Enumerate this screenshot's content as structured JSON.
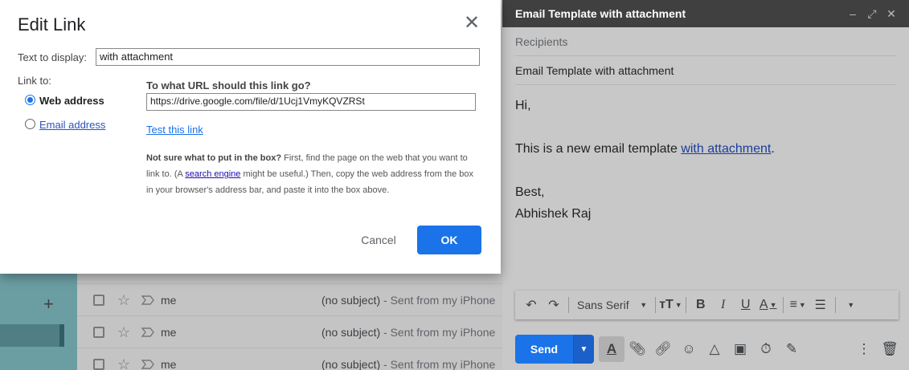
{
  "dialog": {
    "title": "Edit Link",
    "text_to_display_label": "Text to display:",
    "text_to_display_value": "with attachment",
    "link_to_label": "Link to:",
    "options": [
      {
        "label": "Web address",
        "selected": true
      },
      {
        "label": "Email address",
        "selected": false
      }
    ],
    "url_question": "To what URL should this link go?",
    "url_value": "https://drive.google.com/file/d/1Ucj1VmyKQVZRSt",
    "test_link": "Test this link",
    "help_bold": "Not sure what to put in the box?",
    "help_text_1": " First, find the page on the web that you want to link to. (A ",
    "help_link": "search engine",
    "help_text_2": " might be useful.) Then, copy the web address from the box in your browser's address bar, and paste it into the box above.",
    "cancel_label": "Cancel",
    "ok_label": "OK",
    "close_icon": "close-icon"
  },
  "compose": {
    "title": "Email Template with attachment",
    "recipients_placeholder": "Recipients",
    "subject": "Email Template with attachment",
    "body": {
      "line1": "Hi,",
      "line2_prefix": "This is a new email template ",
      "line2_link": "with attachment",
      "line2_suffix": ".",
      "line3": "Best,",
      "line4": "Abhishek Raj"
    },
    "format_bar": {
      "font": "Sans Serif"
    },
    "send_label": "Send"
  },
  "inbox": {
    "rows": [
      {
        "sender": "me",
        "subject": "(no subject)",
        "snippet": " - Sent from my iPhone"
      },
      {
        "sender": "me",
        "subject": "(no subject)",
        "snippet": " - Sent from my iPhone"
      },
      {
        "sender": "me",
        "subject": "(no subject)",
        "snippet": " - Sent from my iPhone"
      }
    ]
  },
  "colors": {
    "accent": "#1a73e8",
    "compose_header": "#404040"
  }
}
